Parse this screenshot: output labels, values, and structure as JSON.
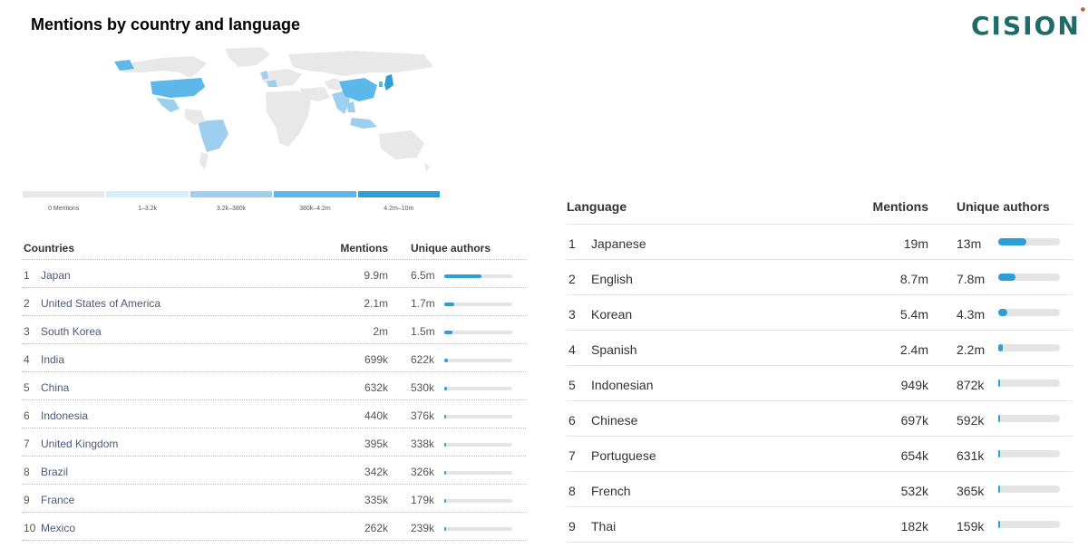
{
  "title": "Mentions by country and language",
  "logo": "CISION",
  "colors": {
    "land_none": "#e8e8e8",
    "tier1": "#d6efff",
    "tier2": "#9fcfee",
    "tier3": "#5cb8ea",
    "tier4": "#2b9fd8",
    "bar": "#2b9fd8"
  },
  "legend": [
    {
      "label": "0 Mentions",
      "color": "#e8e8e8"
    },
    {
      "label": "1–3.2k",
      "color": "#d6efff"
    },
    {
      "label": "3.2k–380k",
      "color": "#9fcfee"
    },
    {
      "label": "380k–4.2m",
      "color": "#5cb8ea"
    },
    {
      "label": "4.2m–10m",
      "color": "#2b9fd8"
    }
  ],
  "countries": {
    "headers": {
      "name": "Countries",
      "mentions": "Mentions",
      "authors": "Unique authors"
    },
    "rows": [
      {
        "rank": "1",
        "name": "Japan",
        "mentions": "9.9m",
        "authors": "6.5m",
        "level": 0.54
      },
      {
        "rank": "2",
        "name": "United States of America",
        "mentions": "2.1m",
        "authors": "1.7m",
        "level": 0.14
      },
      {
        "rank": "3",
        "name": "South Korea",
        "mentions": "2m",
        "authors": "1.5m",
        "level": 0.12
      },
      {
        "rank": "4",
        "name": "India",
        "mentions": "699k",
        "authors": "622k",
        "level": 0.05
      },
      {
        "rank": "5",
        "name": "China",
        "mentions": "632k",
        "authors": "530k",
        "level": 0.044
      },
      {
        "rank": "6",
        "name": "Indonesia",
        "mentions": "440k",
        "authors": "376k",
        "level": 0.031
      },
      {
        "rank": "7",
        "name": "United Kingdom",
        "mentions": "395k",
        "authors": "338k",
        "level": 0.028
      },
      {
        "rank": "8",
        "name": "Brazil",
        "mentions": "342k",
        "authors": "326k",
        "level": 0.027
      },
      {
        "rank": "9",
        "name": "France",
        "mentions": "335k",
        "authors": "179k",
        "level": 0.015
      },
      {
        "rank": "10",
        "name": "Mexico",
        "mentions": "262k",
        "authors": "239k",
        "level": 0.02
      }
    ]
  },
  "languages": {
    "headers": {
      "name": "Language",
      "mentions": "Mentions",
      "authors": "Unique authors"
    },
    "rows": [
      {
        "rank": "1",
        "name": "Japanese",
        "mentions": "19m",
        "authors": "13m",
        "level": 0.46
      },
      {
        "rank": "2",
        "name": "English",
        "mentions": "8.7m",
        "authors": "7.8m",
        "level": 0.28
      },
      {
        "rank": "3",
        "name": "Korean",
        "mentions": "5.4m",
        "authors": "4.3m",
        "level": 0.15
      },
      {
        "rank": "4",
        "name": "Spanish",
        "mentions": "2.4m",
        "authors": "2.2m",
        "level": 0.08
      },
      {
        "rank": "5",
        "name": "Indonesian",
        "mentions": "949k",
        "authors": "872k",
        "level": 0.03
      },
      {
        "rank": "6",
        "name": "Chinese",
        "mentions": "697k",
        "authors": "592k",
        "level": 0.022
      },
      {
        "rank": "7",
        "name": "Portuguese",
        "mentions": "654k",
        "authors": "631k",
        "level": 0.022
      },
      {
        "rank": "8",
        "name": "French",
        "mentions": "532k",
        "authors": "365k",
        "level": 0.015
      },
      {
        "rank": "9",
        "name": "Thai",
        "mentions": "182k",
        "authors": "159k",
        "level": 0.012
      }
    ]
  }
}
